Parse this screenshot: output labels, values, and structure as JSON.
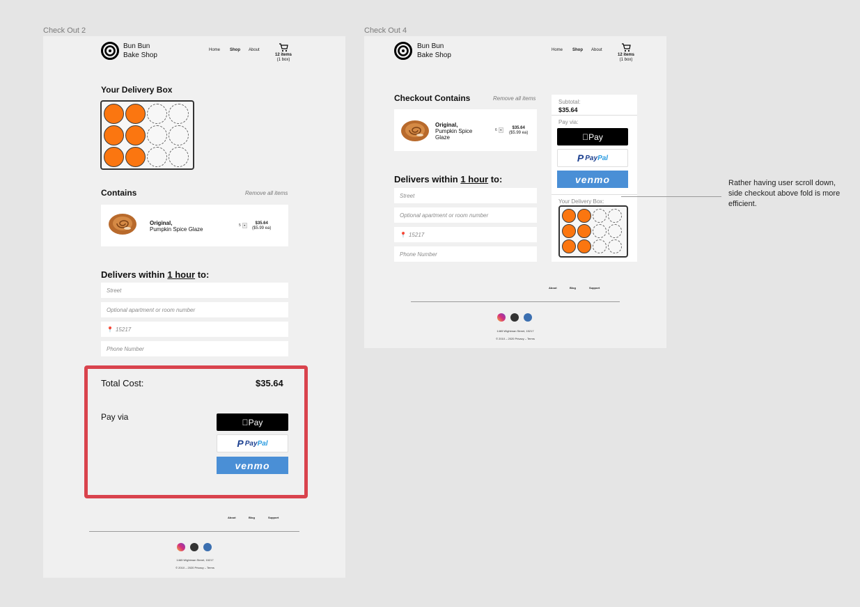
{
  "frames": {
    "left_label": "Check Out 2",
    "right_label": "Check Out 4"
  },
  "brand": {
    "line1": "Bun Bun",
    "line2": "Bake Shop"
  },
  "nav": {
    "home": "Home",
    "shop": "Shop",
    "about": "About"
  },
  "cart": {
    "items": "12 items",
    "boxes": "(1 box)"
  },
  "left": {
    "delivery_box_title": "Your Delivery Box",
    "contains_title": "Contains",
    "remove_all": "Remove all items",
    "item": {
      "name_bold": "Original,",
      "name_rest": "Pumpkin Spice Glaze",
      "qty": "5",
      "price": "$35.64",
      "each": "($5.99 ea)"
    },
    "delivers_prefix": "Delivers within ",
    "delivers_link": "1 hour",
    "delivers_suffix": " to:",
    "fields": {
      "street": "Street",
      "apt": "Optional apartment or room number",
      "zip": "15217",
      "phone": "Phone Number"
    },
    "total_label": "Total Cost:",
    "total_value": "$35.64",
    "pay_via": "Pay via"
  },
  "right": {
    "checkout_title": "Checkout Contains",
    "remove_all": "Remove all items",
    "item": {
      "name_bold": "Original,",
      "name_rest1": "Pumpkin Spice",
      "name_rest2": "Glaze",
      "qty": "6",
      "price": "$35.64",
      "each": "($5.99 ea)"
    },
    "delivers_prefix": "Delivers within ",
    "delivers_link": "1 hour",
    "delivers_suffix": " to:",
    "fields": {
      "street": "Street",
      "apt": "Optional apartment or room number",
      "zip": "15217",
      "phone": "Phone Number"
    },
    "subtotal_label": "Subtotal:",
    "subtotal_value": "$35.64",
    "pay_via": "Pay via:",
    "delivery_box_label": "Your Delivery Box:"
  },
  "payment": {
    "apple": " Pay",
    "paypal_pay": "Pay",
    "paypal_pal": "Pal",
    "venmo": "venmo"
  },
  "box_fill": {
    "filled": 6,
    "total": 12
  },
  "footer": {
    "about": "About",
    "blog": "Blog",
    "support": "Support",
    "address": "1465 Wightman Street, 15217",
    "copyright": "© 2010 – 2020   Privacy – Terms"
  },
  "annotation": "Rather having user scroll down, side checkout above fold is more efficient.",
  "colors": {
    "accent_orange": "#fb7610",
    "highlight_red": "#d9434d",
    "venmo_blue": "#4a8fd6",
    "paypal_navy": "#1b3f8f"
  }
}
